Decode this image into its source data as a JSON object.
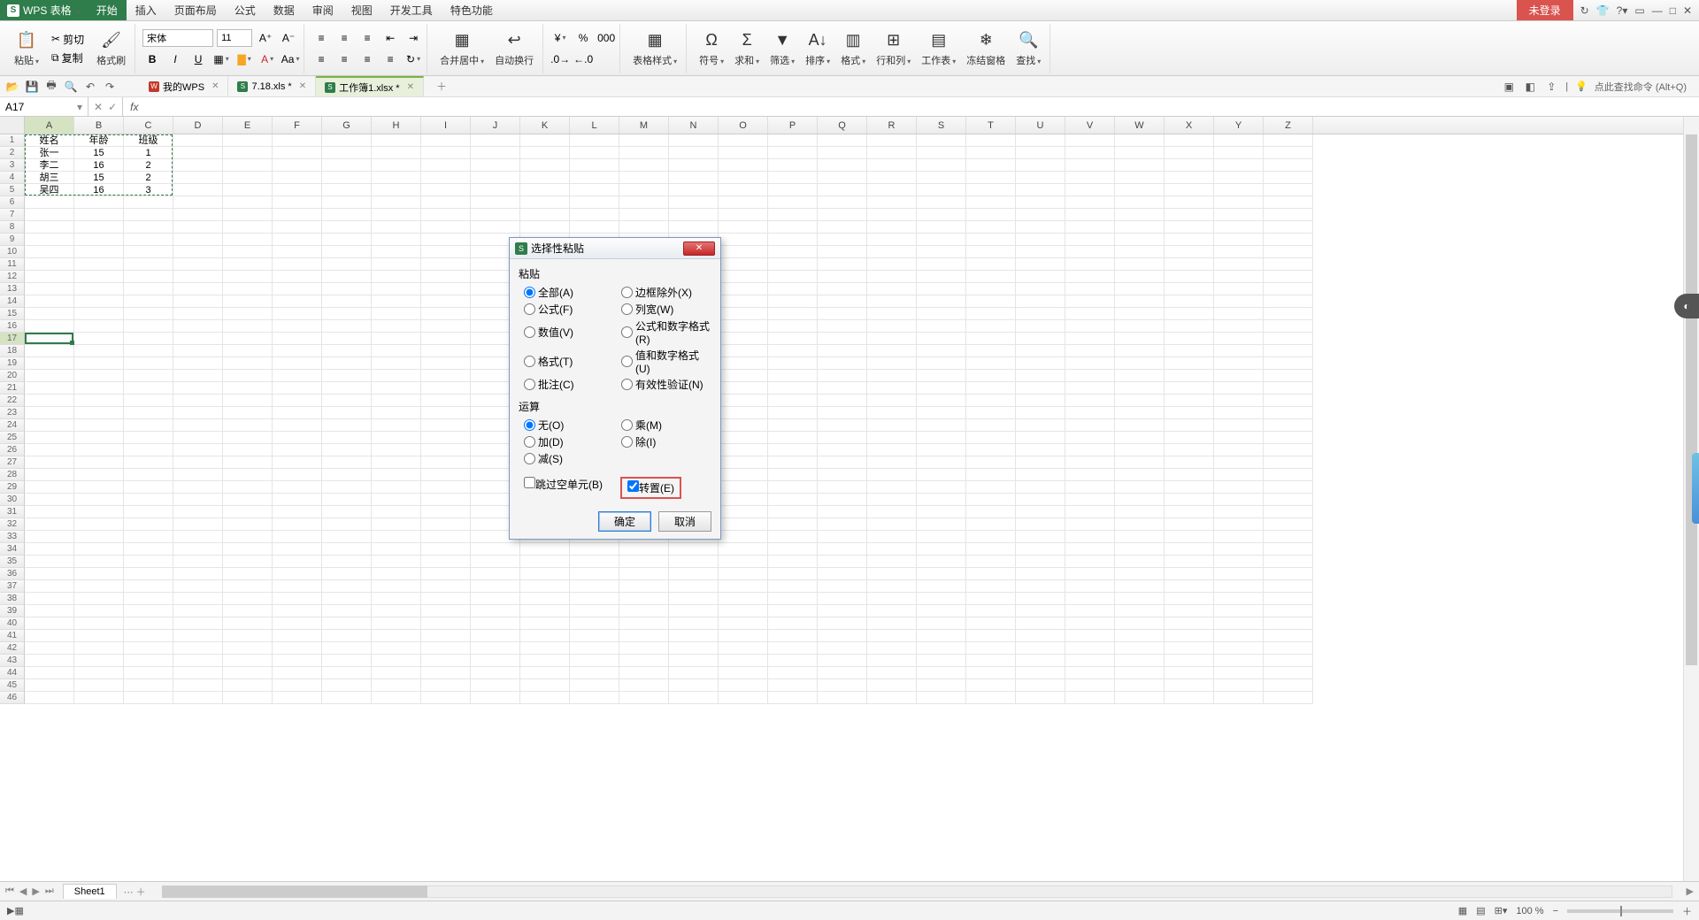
{
  "title_bar": {
    "app_label": "WPS 表格",
    "menu": [
      "开始",
      "插入",
      "页面布局",
      "公式",
      "数据",
      "审阅",
      "视图",
      "开发工具",
      "特色功能"
    ],
    "active_menu_index": 0,
    "login": "未登录"
  },
  "ribbon": {
    "paste": "粘贴",
    "cut": "剪切",
    "copy": "复制",
    "format_painter": "格式刷",
    "font_name": "宋体",
    "font_size": "11",
    "merge": "合并居中",
    "wrap": "自动换行",
    "table_style": "表格样式",
    "symbol": "符号",
    "sum": "求和",
    "filter": "筛选",
    "sort": "排序",
    "format": "格式",
    "rowcol": "行和列",
    "worksheet": "工作表",
    "freeze": "冻结窗格",
    "find": "查找"
  },
  "qat": {
    "doc_tabs": [
      {
        "label": "我的WPS",
        "icon": "W"
      },
      {
        "label": "7.18.xls *",
        "icon": "S"
      },
      {
        "label": "工作簿1.xlsx *",
        "icon": "S"
      }
    ],
    "active_doc": 2,
    "search_hint": "点此查找命令 (Alt+Q)"
  },
  "formula_bar": {
    "name_box": "A17"
  },
  "grid": {
    "columns": [
      "A",
      "B",
      "C",
      "D",
      "E",
      "F",
      "G",
      "H",
      "I",
      "J",
      "K",
      "L",
      "M",
      "N",
      "O",
      "P",
      "Q",
      "R",
      "S",
      "T",
      "U",
      "V",
      "W",
      "X",
      "Y",
      "Z"
    ],
    "row_count": 46,
    "selected_cell": "A17",
    "marquee": {
      "r1": 1,
      "c1": 1,
      "r2": 5,
      "c2": 3
    },
    "data": [
      [
        "姓名",
        "年龄",
        "班级"
      ],
      [
        "张一",
        "15",
        "1"
      ],
      [
        "李二",
        "16",
        "2"
      ],
      [
        "胡三",
        "15",
        "2"
      ],
      [
        "吴四",
        "16",
        "3"
      ]
    ]
  },
  "dialog": {
    "title": "选择性粘贴",
    "group_paste": "粘贴",
    "group_op": "运算",
    "paste_options": [
      "全部(A)",
      "边框除外(X)",
      "公式(F)",
      "列宽(W)",
      "数值(V)",
      "公式和数字格式(R)",
      "格式(T)",
      "值和数字格式(U)",
      "批注(C)",
      "有效性验证(N)"
    ],
    "paste_selected": 0,
    "op_options": [
      "无(O)",
      "乘(M)",
      "加(D)",
      "除(I)",
      "减(S)"
    ],
    "op_selected": 0,
    "skip_blanks": "跳过空单元(B)",
    "transpose": "转置(E)",
    "transpose_checked": true,
    "ok": "确定",
    "cancel": "取消"
  },
  "sheet_bar": {
    "sheet": "Sheet1"
  },
  "status": {
    "zoom": "100 %"
  }
}
